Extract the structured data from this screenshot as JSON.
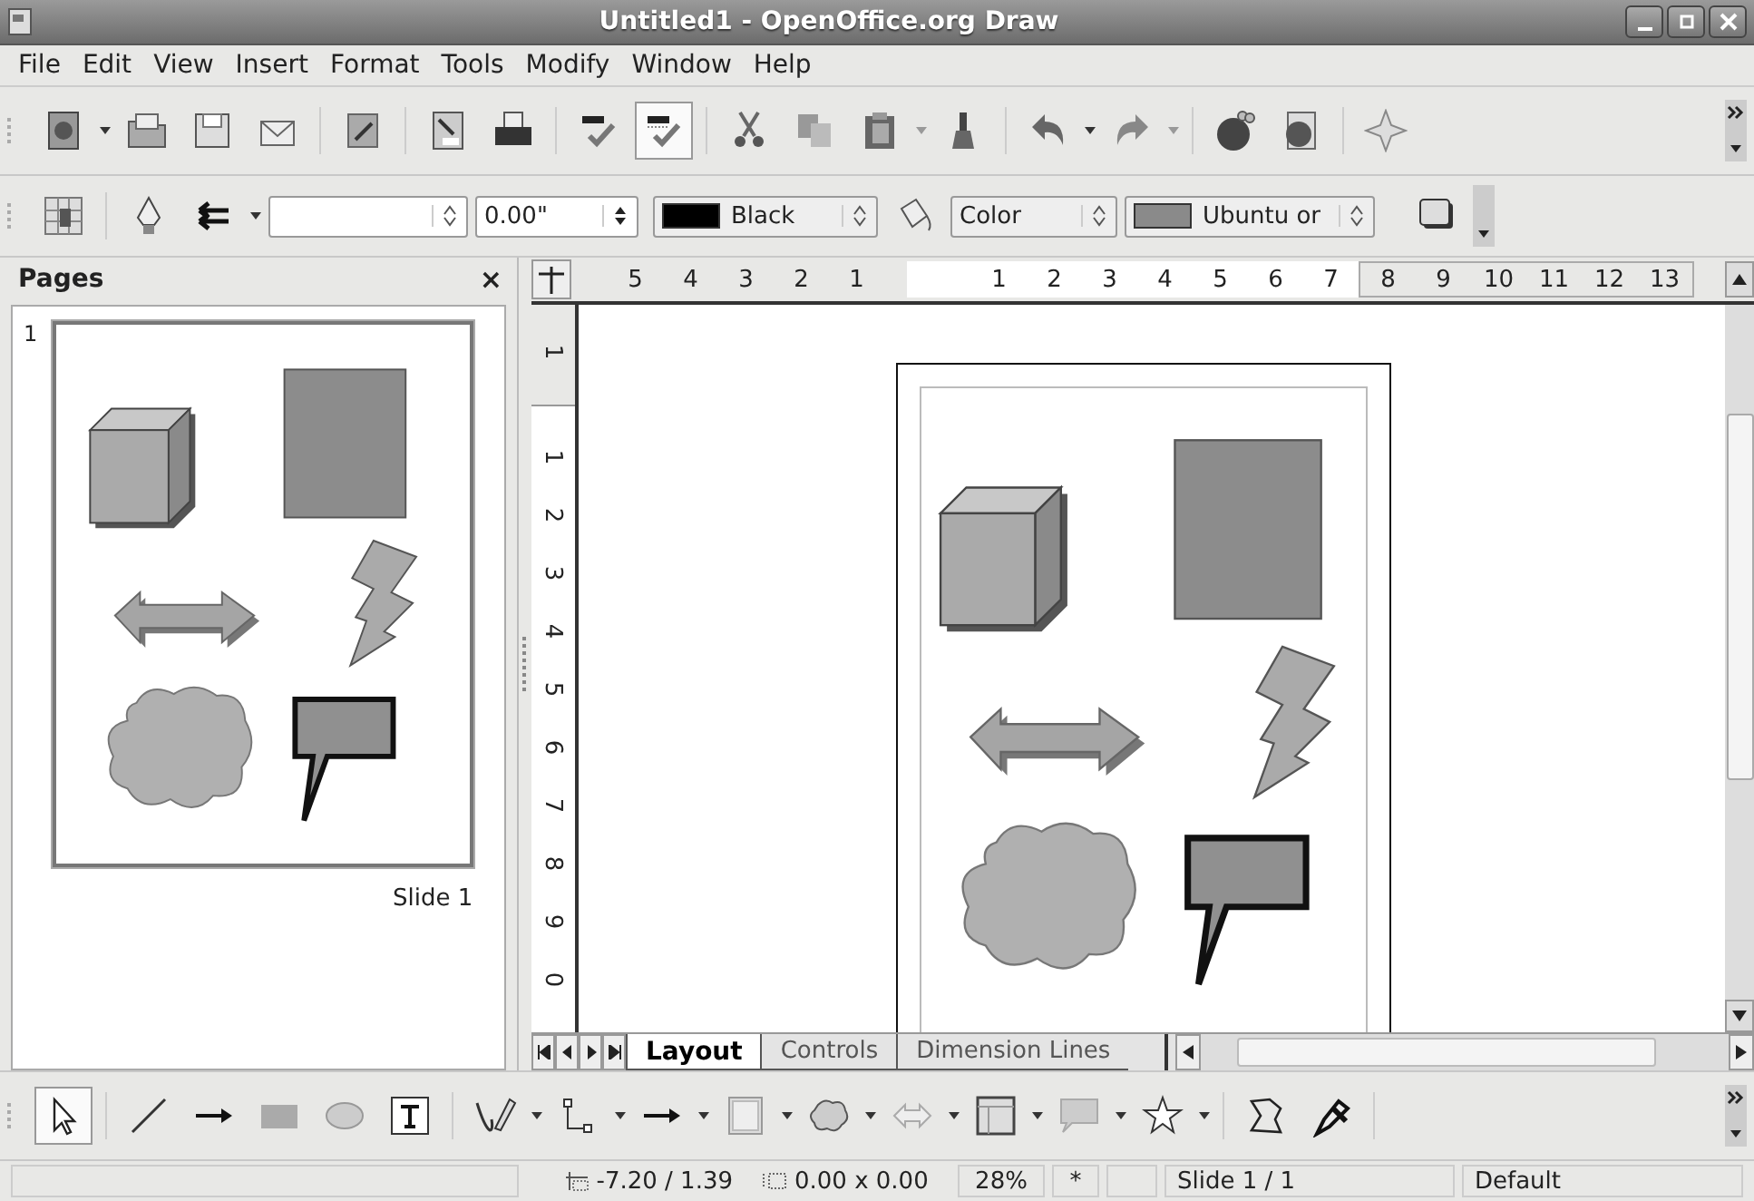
{
  "window": {
    "title": "Untitled1 - OpenOffice.org Draw"
  },
  "menu": [
    "File",
    "Edit",
    "View",
    "Insert",
    "Format",
    "Tools",
    "Modify",
    "Window",
    "Help"
  ],
  "standard_toolbar": {
    "auto_spellcheck_on": true
  },
  "line_toolbar": {
    "line_width": {
      "value": "0.00\""
    },
    "line_color": {
      "value": "Black",
      "color": "#000000"
    },
    "area_style": {
      "value": "Color"
    },
    "fill": {
      "value": "Ubuntu or",
      "color": "#8a8a8a"
    }
  },
  "pages_panel": {
    "title": "Pages",
    "close": "×",
    "pages": [
      {
        "number": "1",
        "caption": "Slide 1",
        "selected": true
      }
    ]
  },
  "ruler": {
    "before_origin": [
      "5",
      "4",
      "3",
      "2",
      "1"
    ],
    "after_origin": [
      "1",
      "2",
      "3",
      "4",
      "5",
      "6",
      "7",
      "8",
      "9",
      "10",
      "11",
      "12",
      "13"
    ],
    "vertical_above": [
      "1"
    ],
    "vertical_below": [
      "2",
      "3",
      "4",
      "5",
      "6",
      "7",
      "8",
      "9",
      "0"
    ],
    "vertical_first": "1"
  },
  "tabs": [
    {
      "label": "Layout",
      "selected": true
    },
    {
      "label": "Controls",
      "selected": false
    },
    {
      "label": "Dimension Lines",
      "selected": false
    }
  ],
  "drawing_toolbar": {
    "select_on": true
  },
  "status_bar": {
    "position": "-7.20 / 1.39",
    "size": "0.00 x 0.00",
    "zoom": "28%",
    "modified": "*",
    "slide": "Slide 1 / 1",
    "layout": "Default"
  }
}
